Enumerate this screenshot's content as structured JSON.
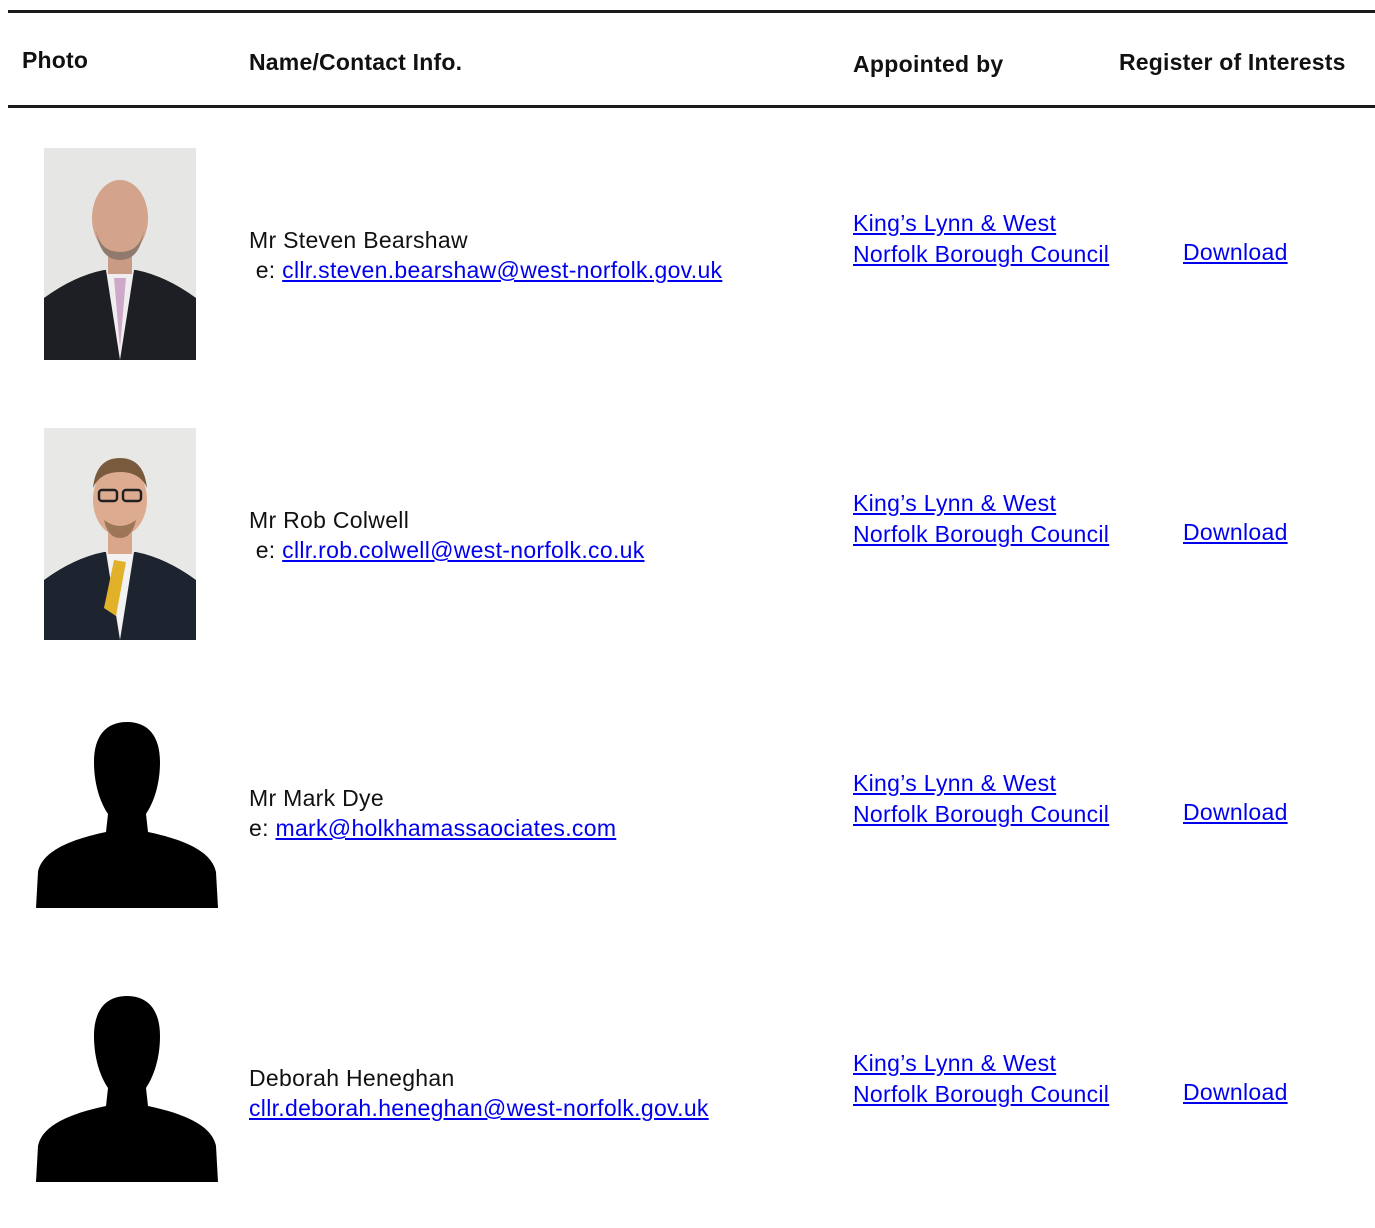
{
  "table": {
    "headers": {
      "photo": "Photo",
      "name": "Name/Contact Info.",
      "appointed": "Appointed by",
      "register": "Register of Interests"
    },
    "rows": [
      {
        "photo": "portrait-photo",
        "name": "Mr Steven Bearshaw",
        "email_prefix": " e: ",
        "email": "cllr.steven.bearshaw@west-norfolk.gov.uk",
        "appointed_by": "King’s Lynn & West Norfolk Borough Council",
        "register": "Download"
      },
      {
        "photo": "portrait-photo",
        "name": "Mr Rob Colwell",
        "email_prefix": " e: ",
        "email": "cllr.rob.colwell@west-norfolk.co.uk",
        "appointed_by": "King’s Lynn & West Norfolk Borough Council",
        "register": "Download"
      },
      {
        "photo": "silhouette-placeholder",
        "name": "Mr Mark Dye",
        "email_prefix": "e: ",
        "email": "mark@holkhamassaociates.com",
        "appointed_by": "King’s Lynn & West Norfolk Borough Council",
        "register": "Download"
      },
      {
        "photo": "silhouette-placeholder",
        "name": "Deborah Heneghan",
        "email_prefix": "",
        "email": "cllr.deborah.heneghan@west-norfolk.gov.uk",
        "appointed_by": "King’s Lynn & West Norfolk Borough Council",
        "register": "Download"
      }
    ]
  },
  "colors": {
    "link": "#0000ee",
    "text": "#111111",
    "rule": "#1a1a1a"
  }
}
